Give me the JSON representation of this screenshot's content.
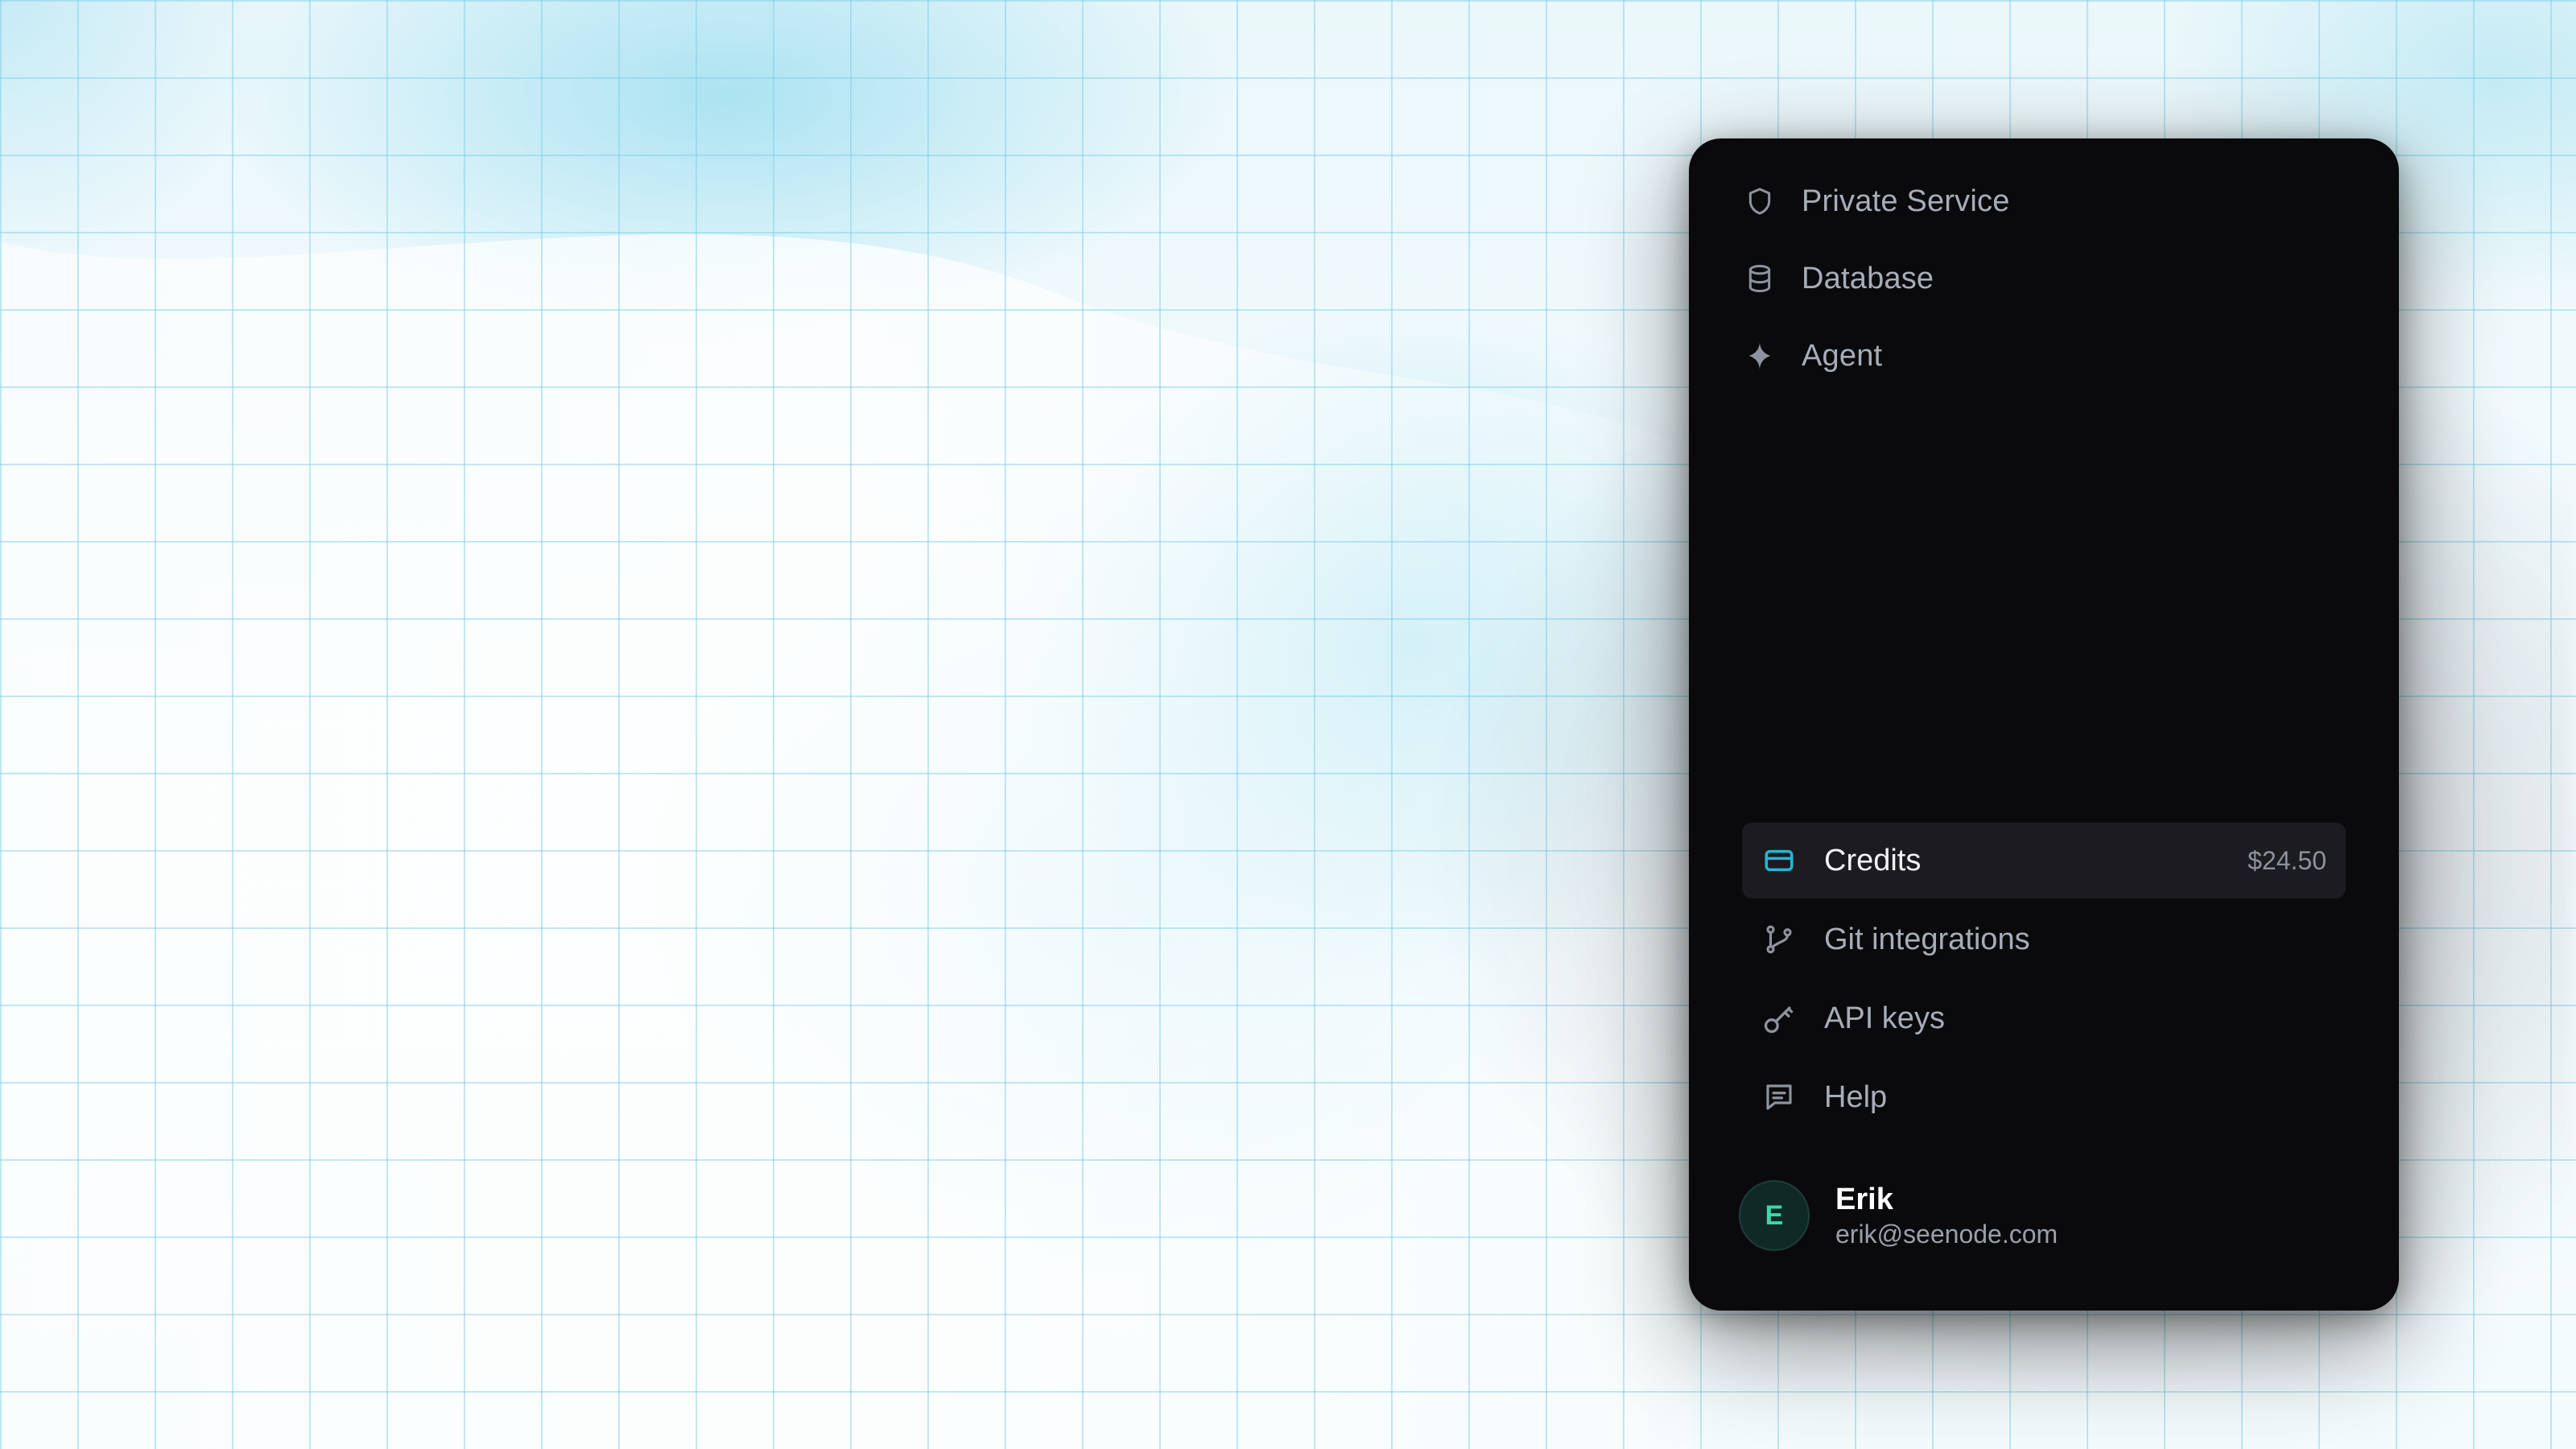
{
  "sidebar": {
    "top_items": [
      {
        "label": "Private Service",
        "icon": "shield-icon"
      },
      {
        "label": "Database",
        "icon": "database-icon"
      },
      {
        "label": "Agent",
        "icon": "sparkle-icon"
      }
    ],
    "bottom_items": [
      {
        "label": "Credits",
        "icon": "credit-card-icon",
        "value": "$24.50",
        "active": true
      },
      {
        "label": "Git integrations",
        "icon": "git-branch-icon"
      },
      {
        "label": "API keys",
        "icon": "key-icon"
      },
      {
        "label": "Help",
        "icon": "message-square-icon"
      }
    ]
  },
  "user": {
    "initial": "E",
    "name": "Erik",
    "email": "erik@seenode.com"
  },
  "colors": {
    "panel_bg": "#0a0a0d",
    "accent": "#22b8d6",
    "avatar_text": "#3fd6a8",
    "text_muted": "#a7adb8"
  }
}
